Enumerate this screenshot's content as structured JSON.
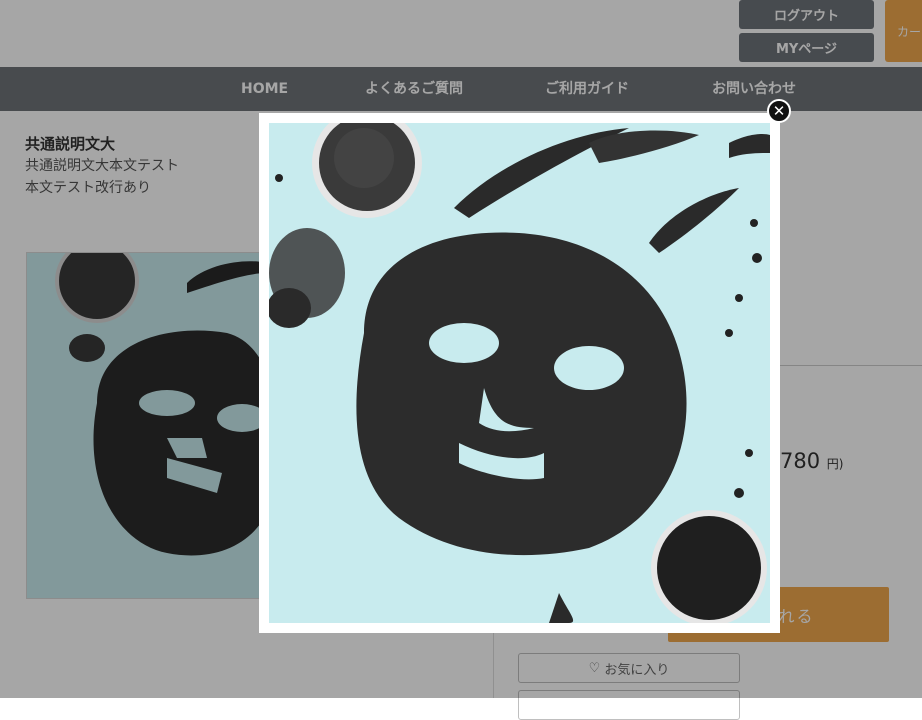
{
  "header": {
    "logout_label": "ログアウト",
    "mypage_label": "MYページ",
    "cart_label": "カー"
  },
  "nav": {
    "items": [
      "HOME",
      "よくあるご質問",
      "ご利用ガイド",
      "お問い合わせ"
    ]
  },
  "description": {
    "title": "共通説明文大",
    "line1": "共通説明文大本文テスト",
    "line2": "本文テスト改行あり"
  },
  "product": {
    "price": "780",
    "price_unit": "円)",
    "add_to_cart_label": "に入れる",
    "favorite_label": "お気に入り"
  },
  "lightbox": {
    "close_symbol": "✕"
  },
  "colors": {
    "accent": "#f0a84e",
    "nav": "#6f7479",
    "photo_bg": "#c8ebee",
    "mask": "#2c2c2c"
  }
}
